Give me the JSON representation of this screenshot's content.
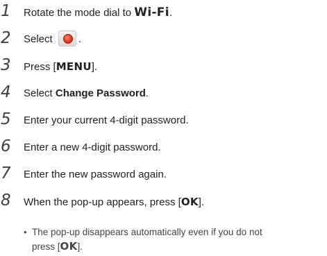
{
  "steps": [
    {
      "num": "1",
      "pre": "Rotate the mode dial to ",
      "key": "Wi-Fi",
      "post": "."
    },
    {
      "num": "2",
      "pre": "Select ",
      "icon": "wifi-mode-red-icon",
      "post": "."
    },
    {
      "num": "3",
      "pre": "Press [",
      "key": "MENU",
      "post": "]."
    },
    {
      "num": "4",
      "pre": "Select ",
      "bold": "Change Password",
      "post": "."
    },
    {
      "num": "5",
      "text": "Enter your current 4-digit password."
    },
    {
      "num": "6",
      "text": "Enter a new 4-digit password."
    },
    {
      "num": "7",
      "text": "Enter the new password again."
    },
    {
      "num": "8",
      "pre": "When the pop-up appears, press [",
      "key": "OK",
      "post": "]."
    }
  ],
  "note": {
    "bullet": "•",
    "line1": "The pop-up disappears automatically even if you do not",
    "line2_pre": "press [",
    "line2_key": "OK",
    "line2_post": "]."
  }
}
